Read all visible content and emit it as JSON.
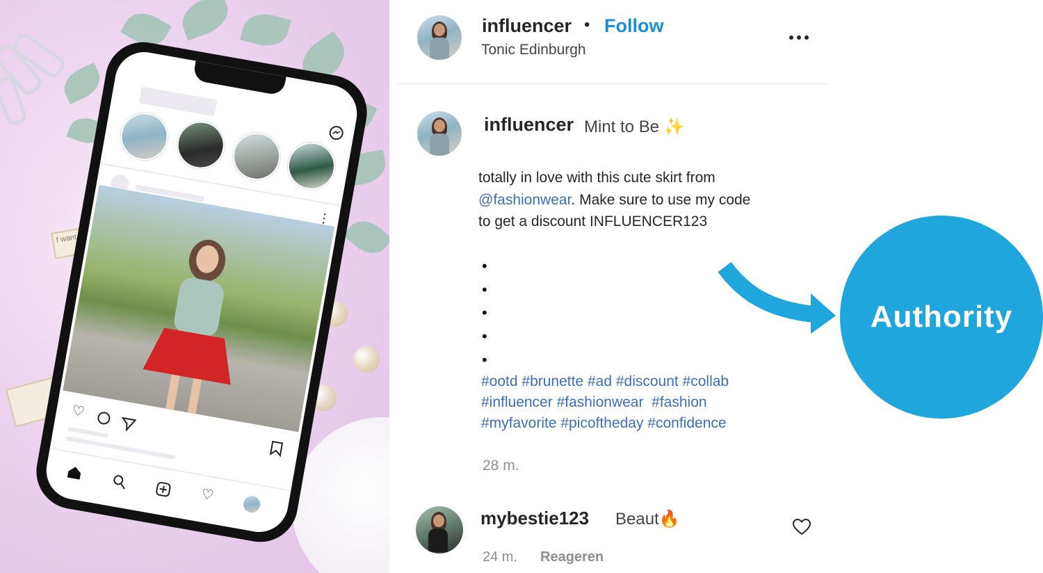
{
  "colors": {
    "accent_blue": "#0095f6",
    "link_blue": "#3b6fb6",
    "authority_blue": "#1fa6dd",
    "text_dark": "#262626",
    "text_muted": "#8e8e8e"
  },
  "post_header": {
    "username": "influencer",
    "separator": "•",
    "follow_label": "Follow",
    "location": "Tonic Edinburgh",
    "more_icon": "more-horizontal-icon"
  },
  "caption": {
    "username": "influencer",
    "title": "Mint to Be",
    "sparkle": "✨",
    "text_before": "totally in love with this cute skirt from ",
    "mention": "@fashionwear",
    "text_after": ". Make sure to use my code to get a discount INFLUENCER123",
    "bullets": [
      "•",
      "•",
      "•",
      "•",
      "•"
    ],
    "hashtag_lines": [
      "#ootd #brunette #ad #discount #collab",
      "#influencer #fashionwear  #fashion",
      "#myfavorite #picoftheday #confidence"
    ],
    "time": "28 m."
  },
  "comment": {
    "username": "mybestie123",
    "text": "Beaut",
    "emoji": "🔥",
    "time": "24 m.",
    "reply_label": "Reageren",
    "like_icon": "heart-outline-icon"
  },
  "annotation": {
    "label": "Authority"
  },
  "phone": {
    "nav_icons": [
      "home-icon",
      "search-icon",
      "add-post-icon",
      "heart-icon",
      "profile-avatar-icon"
    ],
    "action_icons": [
      "heart-icon",
      "comment-icon",
      "share-icon",
      "bookmark-icon"
    ],
    "top_icon": "messenger-icon",
    "binder_text": "f want"
  }
}
